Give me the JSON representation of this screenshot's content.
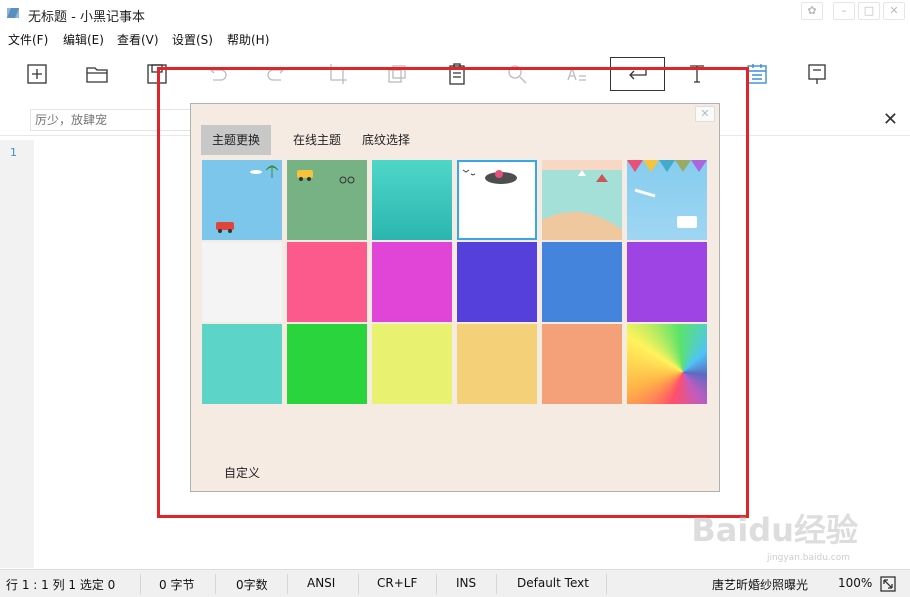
{
  "window": {
    "title": "无标题 - 小黑记事本",
    "controls": [
      "shirt-icon",
      "minimize-icon",
      "maximize-icon",
      "close-icon"
    ]
  },
  "menu": [
    {
      "label": "文件(F)"
    },
    {
      "label": "编辑(E)"
    },
    {
      "label": "查看(V)"
    },
    {
      "label": "设置(S)"
    },
    {
      "label": "帮助(H)"
    }
  ],
  "toolbar": [
    {
      "icon": "new-file-icon"
    },
    {
      "icon": "open-folder-icon"
    },
    {
      "icon": "save-icon"
    },
    {
      "icon": "undo-icon"
    },
    {
      "icon": "redo-icon"
    },
    {
      "icon": "crop-icon"
    },
    {
      "icon": "copy-icon"
    },
    {
      "icon": "paste-icon"
    },
    {
      "icon": "find-icon"
    },
    {
      "icon": "replace-case-icon"
    },
    {
      "icon": "word-wrap-icon",
      "active": true
    },
    {
      "icon": "font-icon"
    },
    {
      "icon": "theme-icon",
      "color": "#3a8fd6"
    },
    {
      "icon": "pin-note-icon"
    }
  ],
  "search": {
    "placeholder": "厉少，放肆宠"
  },
  "editor": {
    "line_number": "1"
  },
  "dialog": {
    "tabs": [
      {
        "label": "主题更换",
        "active": true
      },
      {
        "label": "在线主题"
      },
      {
        "label": "底纹选择"
      }
    ],
    "swatches": [
      {
        "name": "sky-bus",
        "color": "#7cc6ec"
      },
      {
        "name": "green-car",
        "color": "#76b283"
      },
      {
        "name": "teal-sea",
        "color": "#3cc7bd"
      },
      {
        "name": "white-ink",
        "color": "#ffffff",
        "selected": true
      },
      {
        "name": "beach",
        "color": "#a4e0d8"
      },
      {
        "name": "flags-car",
        "color": "#86ccef"
      },
      {
        "name": "light-gray",
        "color": "#f4f4f4"
      },
      {
        "name": "pink",
        "color": "#fc5a8c"
      },
      {
        "name": "magenta",
        "color": "#e145d8"
      },
      {
        "name": "indigo",
        "color": "#5540dc"
      },
      {
        "name": "blue",
        "color": "#4484dc"
      },
      {
        "name": "purple",
        "color": "#9e44e4"
      },
      {
        "name": "turquoise",
        "color": "#5cd4c8"
      },
      {
        "name": "green",
        "color": "#2ad43c"
      },
      {
        "name": "yellow",
        "color": "#e8f270"
      },
      {
        "name": "amber",
        "color": "#f4d078"
      },
      {
        "name": "salmon",
        "color": "#f4a078"
      },
      {
        "name": "rainbow",
        "color": "gradient"
      }
    ],
    "custom_label": "自定义"
  },
  "status": {
    "position": "行 1 : 1   列 1   选定 0",
    "bytes": "0 字节",
    "chars": "0字数",
    "encoding": "ANSI",
    "line_ending": "CR+LF",
    "insert_mode": "INS",
    "text_mode": "Default Text",
    "song": "唐艺昕婚纱照曝光",
    "zoom": "100%"
  },
  "watermark": {
    "text": "Baidu经验",
    "sub": "jingyan.baidu.com"
  },
  "colors": {
    "annotation": "#e0252a",
    "dialog_bg": "#f5ebe3",
    "accent": "#3a8fd6"
  }
}
